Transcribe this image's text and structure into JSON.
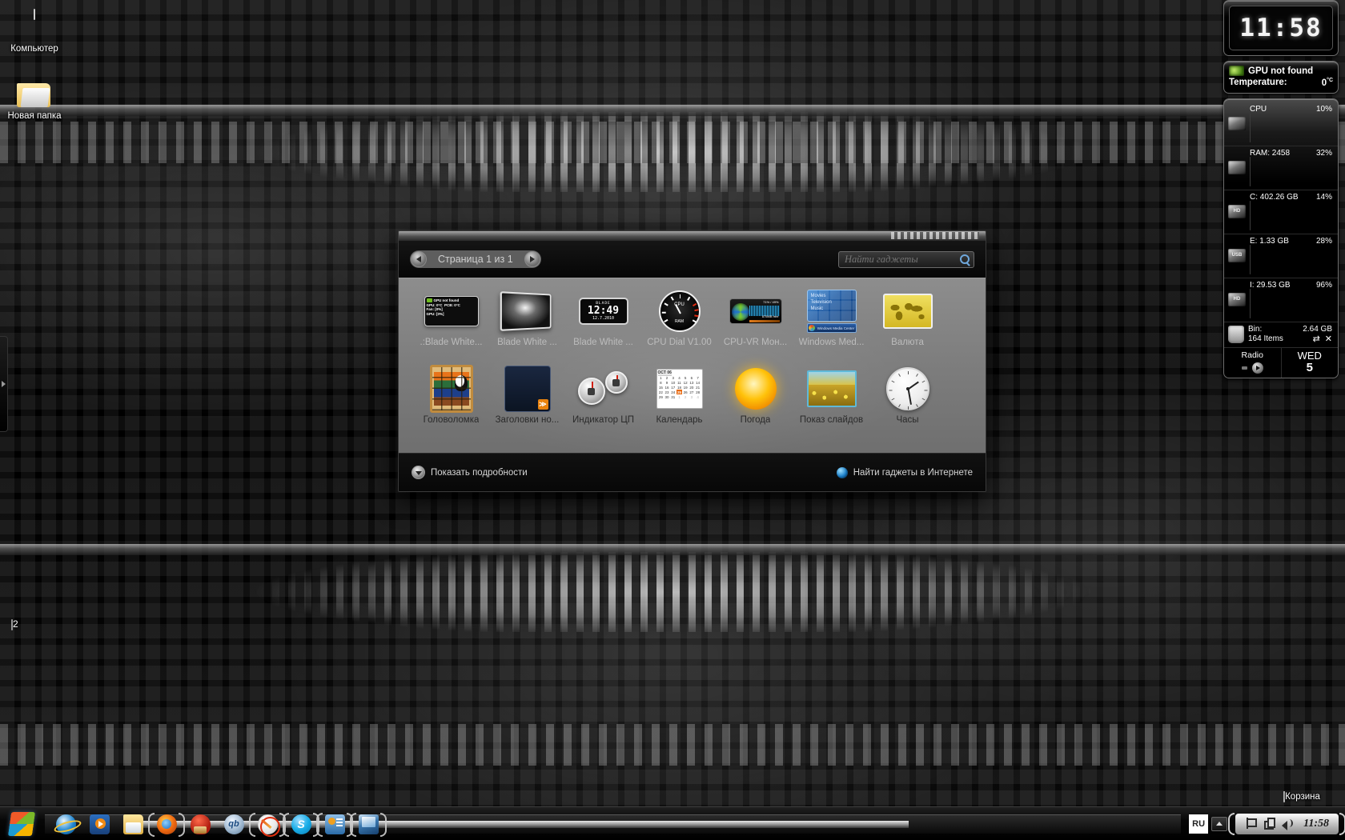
{
  "desktop": {
    "icons": [
      {
        "name": "computer",
        "label": "Компьютер"
      },
      {
        "name": "new-folder",
        "label": "Новая папка"
      },
      {
        "name": "recycle-bin",
        "label": "Корзина"
      }
    ],
    "mini_widget": {
      "value": "2"
    }
  },
  "sidebar": {
    "clock": {
      "time": "11:58"
    },
    "gpu": {
      "title": "GPU not found",
      "temp_label": "Temperature:",
      "temp_value": "0",
      "temp_unit": "°C"
    },
    "resources": [
      {
        "icon": "cpu-icon",
        "label": "CPU",
        "value": "10%",
        "percent": 10
      },
      {
        "icon": "ram-icon",
        "label": "RAM: 2458",
        "value": "32%",
        "percent": 32
      },
      {
        "icon": "hdd-icon",
        "label": "C:   402.26 GB",
        "value": "14%",
        "percent": 14
      },
      {
        "icon": "usb-icon",
        "label": "E:      1.33 GB",
        "value": "28%",
        "percent": 28
      },
      {
        "icon": "hdd-icon",
        "label": "I:    29.53 GB",
        "value": "96%",
        "percent": 96
      }
    ],
    "bin": {
      "label": "Bin:",
      "size": "2.64 GB",
      "items": "164 Items"
    },
    "radio": {
      "label": "Radio"
    },
    "day": {
      "weekday": "WED",
      "date": "5"
    }
  },
  "gallery": {
    "pager": {
      "prev": "◀",
      "next": "▶",
      "label": "Страница 1 из 1"
    },
    "search": {
      "placeholder": "Найти гаджеты",
      "value": ""
    },
    "tiles_row1": [
      {
        "name": "gadget-blade-white-gpu",
        "label": ".:Blade White...",
        "thumb": "gpu-panel",
        "muted": true
      },
      {
        "name": "gadget-blade-white-tv",
        "label": "Blade White ...",
        "thumb": "tv",
        "muted": true
      },
      {
        "name": "gadget-blade-white-clock",
        "label": "Blade White ...",
        "thumb": "lcd-clock",
        "muted": true
      },
      {
        "name": "gadget-cpu-dial",
        "label": "CPU Dial V1.00",
        "thumb": "dial",
        "muted": true
      },
      {
        "name": "gadget-cpu-vr-monitor",
        "label": "CPU-VR Мон...",
        "thumb": "cpu-vr",
        "muted": true
      },
      {
        "name": "gadget-windows-media-center",
        "label": "Windows Med...",
        "thumb": "wmc",
        "muted": true
      },
      {
        "name": "gadget-currency",
        "label": "Валюта",
        "thumb": "world-map",
        "muted": true
      }
    ],
    "tiles_row2": [
      {
        "name": "gadget-puzzle",
        "label": "Головоломка",
        "thumb": "puzzle",
        "muted": false
      },
      {
        "name": "gadget-news-headlines",
        "label": "Заголовки но...",
        "thumb": "rss",
        "muted": false
      },
      {
        "name": "gadget-cpu-meter",
        "label": "Индикатор ЦП",
        "thumb": "cpu-meter",
        "muted": false
      },
      {
        "name": "gadget-calendar",
        "label": "Календарь",
        "thumb": "calendar",
        "muted": false
      },
      {
        "name": "gadget-weather",
        "label": "Погода",
        "thumb": "sun",
        "muted": false
      },
      {
        "name": "gadget-slideshow",
        "label": "Показ слайдов",
        "thumb": "slideshow",
        "muted": false
      },
      {
        "name": "gadget-clock",
        "label": "Часы",
        "thumb": "analog-clock",
        "muted": false
      }
    ],
    "calendar_thumb": {
      "title": "ОСТ 06",
      "weeks": [
        [
          "1",
          "2",
          "3",
          "4",
          "5",
          "6",
          "7"
        ],
        [
          "8",
          "9",
          "10",
          "11",
          "12",
          "13",
          "14"
        ],
        [
          "15",
          "16",
          "17",
          "18",
          "19",
          "20",
          "21"
        ],
        [
          "22",
          "23",
          "24",
          "25",
          "26",
          "27",
          "28"
        ],
        [
          "29",
          "30",
          "31",
          "1",
          "2",
          "3",
          "4"
        ]
      ],
      "highlight": "25"
    },
    "footer": {
      "details_label": "Показать подробности",
      "online_label": "Найти гаджеты в Интернете"
    }
  },
  "taskbar": {
    "start_label": "Пуск",
    "items": [
      {
        "name": "taskbar-internet-explorer",
        "icon": "ie-icon",
        "grouped": false
      },
      {
        "name": "taskbar-windows-media-player",
        "icon": "wmp-icon",
        "grouped": false
      },
      {
        "name": "taskbar-explorer",
        "icon": "explorer-icon",
        "grouped": false
      },
      {
        "name": "taskbar-firefox",
        "icon": "firefox-icon",
        "grouped": true
      },
      {
        "name": "taskbar-ccleaner",
        "icon": "ccleaner-icon",
        "grouped": false
      },
      {
        "name": "taskbar-qbittorrent",
        "icon": "qbittorrent-icon",
        "grouped": false
      },
      {
        "name": "taskbar-editor",
        "icon": "pen-icon",
        "grouped": true
      },
      {
        "name": "taskbar-skype",
        "icon": "skype-icon",
        "grouped": true
      },
      {
        "name": "taskbar-system-tool",
        "icon": "system-icon",
        "grouped": true
      },
      {
        "name": "taskbar-monitor-tool",
        "icon": "monitor-icon",
        "grouped": true
      }
    ],
    "tray": {
      "language": "RU",
      "icons": [
        {
          "name": "action-center-flag-icon"
        },
        {
          "name": "network-icon"
        },
        {
          "name": "volume-icon"
        }
      ],
      "clock": "11:58"
    }
  },
  "colors": {
    "accent": "#6fa8dc",
    "gallery_body": "#7d7d7d",
    "window_bg": "#0a0a0a",
    "highlight_orange": "#e86a10"
  }
}
